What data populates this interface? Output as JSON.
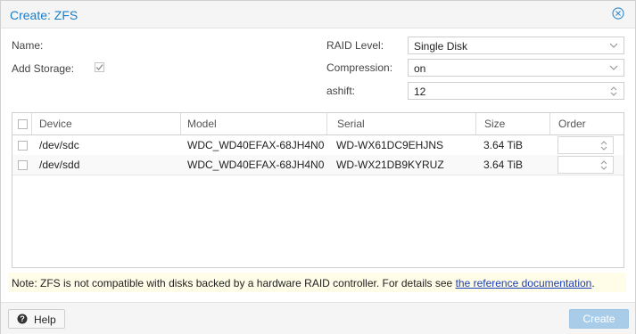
{
  "window": {
    "title": "Create: ZFS",
    "close_icon": "close-circle-icon"
  },
  "form": {
    "name_label": "Name:",
    "name_value": "",
    "add_storage_label": "Add Storage:",
    "add_storage_checked": true,
    "raid_level_label": "RAID Level:",
    "raid_level_value": "Single Disk",
    "compression_label": "Compression:",
    "compression_value": "on",
    "ashift_label": "ashift:",
    "ashift_value": "12"
  },
  "disk_grid": {
    "columns": [
      "Device",
      "Model",
      "Serial",
      "Size",
      "Order"
    ],
    "rows": [
      {
        "device": "/dev/sdc",
        "model": "WDC_WD40EFAX-68JH4N0",
        "serial": "WD-WX61DC9EHJNS",
        "size": "3.64 TiB",
        "order": ""
      },
      {
        "device": "/dev/sdd",
        "model": "WDC_WD40EFAX-68JH4N0",
        "serial": "WD-WX21DB9KYRUZ",
        "size": "3.64 TiB",
        "order": ""
      }
    ]
  },
  "note": {
    "text": "Note: ZFS is not compatible with disks backed by a hardware RAID controller. For details see ",
    "link": "the reference documentation",
    "suffix": "."
  },
  "footer": {
    "help_label": "Help",
    "create_label": "Create"
  },
  "colors": {
    "title": "#157fcc",
    "create_disabled": "#a9cde9",
    "note_bg": "#fffce8",
    "link": "#1a3cb8"
  }
}
